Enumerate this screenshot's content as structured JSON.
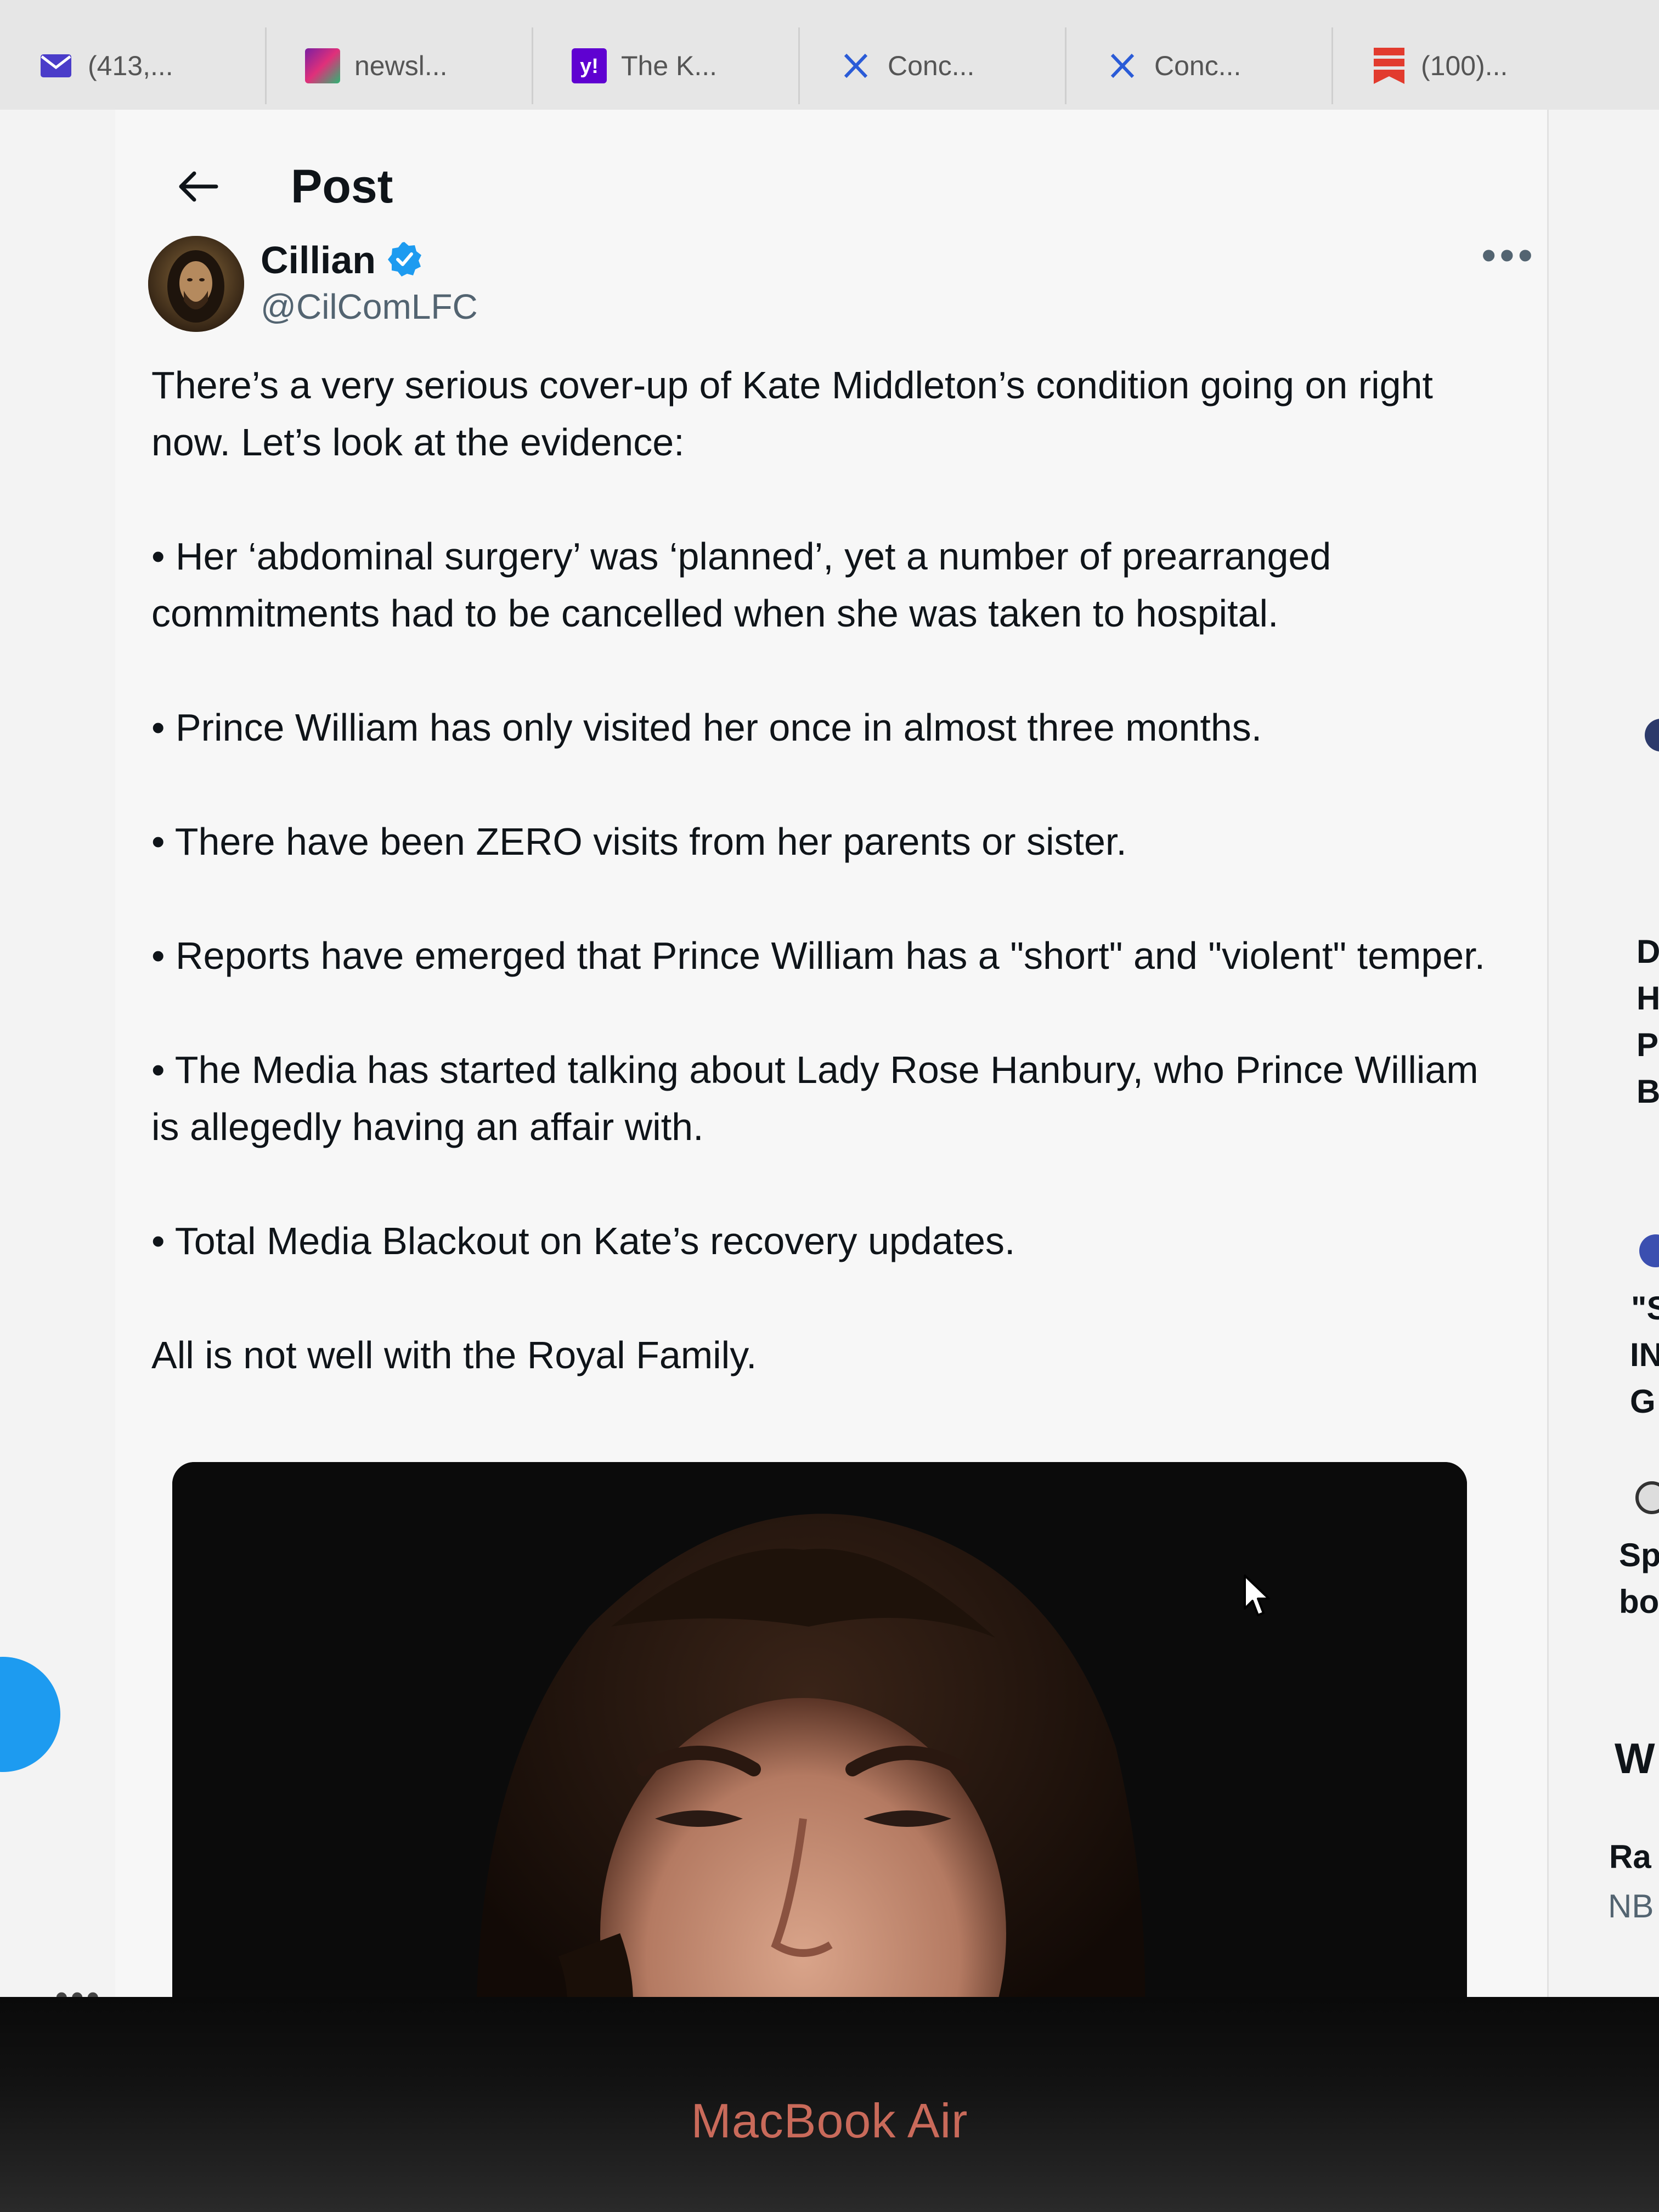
{
  "tabs": [
    {
      "label": "(413,...",
      "icon": "mail-icon"
    },
    {
      "label": "newsl...",
      "icon": "gradient-favicon-icon"
    },
    {
      "label": "The K...",
      "icon": "yahoo-icon"
    },
    {
      "label": "Conc...",
      "icon": "x-icon"
    },
    {
      "label": "Conc...",
      "icon": "x-icon"
    },
    {
      "label": "(100)...",
      "icon": "bookmark-icon"
    }
  ],
  "header": {
    "title": "Post"
  },
  "post": {
    "author_name": "Cillian",
    "author_handle": "@CilComLFC",
    "paragraphs": [
      "There’s a very serious cover-up of Kate Middleton’s condition going on right now. Let’s look at the evidence:",
      "• Her ‘abdominal surgery’ was ‘planned’, yet a number of prearranged commitments had to be cancelled when she was taken to hospital.",
      "• Prince William has only visited her once in almost three months.",
      "• There have been ZERO visits from her parents or sister.",
      "• Reports have emerged that Prince William has a \"short\" and \"violent\" temper.",
      "• The Media has started talking about Lady Rose Hanbury, who Prince William is allegedly having an affair with.",
      "• Total Media Blackout on Kate’s recovery updates.",
      "All is not well with the Royal Family."
    ]
  },
  "sidebar_fragments": [
    "D",
    "H",
    "P",
    "B",
    "\"S",
    "IN",
    "G",
    "Sp",
    "bo",
    "W",
    "Ra",
    "NB"
  ],
  "bezel": {
    "brand": "MacBook Air"
  },
  "colors": {
    "accent": "#1d9bf0",
    "text": "#0f1419",
    "muted": "#536471"
  }
}
